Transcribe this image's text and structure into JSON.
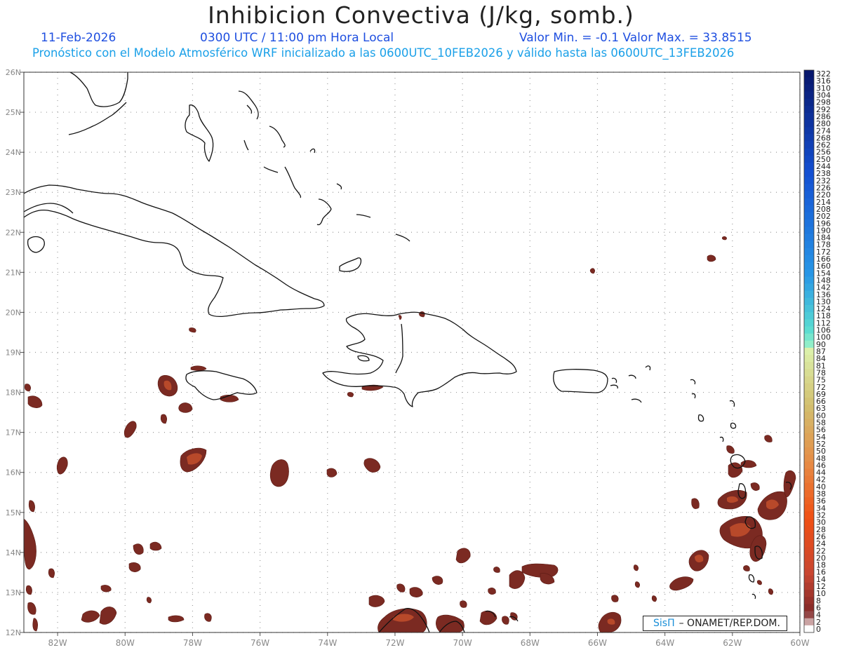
{
  "title": "Inhibicion Convectiva (J/kg, somb.)",
  "header": {
    "date": "11-Feb-2026",
    "time": "0300 UTC / 11:00 pm Hora Local",
    "minmax": "Valor Min. = -0.1  Valor Max. = 33.8515",
    "forecast": "Pronóstico con el Modelo Atmosférico WRF inicializado a las 0600UTC_10FEB2026 y válido hasta las  0600UTC_13FEB2026"
  },
  "map": {
    "lon_range": [
      -83,
      -60
    ],
    "lat_range": [
      12,
      26
    ],
    "lon_labels": [
      "82W",
      "80W",
      "78W",
      "76W",
      "74W",
      "72W",
      "70W",
      "68W",
      "66W",
      "64W",
      "62W",
      "60W"
    ],
    "lon_values": [
      -82,
      -80,
      -78,
      -76,
      -74,
      -72,
      -70,
      -68,
      -66,
      -64,
      -62,
      -60
    ],
    "lat_labels": [
      "26N",
      "25N",
      "24N",
      "23N",
      "22N",
      "21N",
      "20N",
      "19N",
      "18N",
      "17N",
      "16N",
      "15N",
      "14N",
      "13N",
      "12N"
    ],
    "lat_values": [
      26,
      25,
      24,
      23,
      22,
      21,
      20,
      19,
      18,
      17,
      16,
      15,
      14,
      13,
      12
    ],
    "colors": {
      "coast": "#111111",
      "grid": "#9a9a9a",
      "axis_text": "#888888",
      "shade_dark": "#7b2a22",
      "shade_mid": "#9a3a26",
      "shade_light": "#c8502a"
    }
  },
  "colorbar": {
    "labels": [
      "322",
      "316",
      "310",
      "304",
      "298",
      "292",
      "286",
      "280",
      "274",
      "268",
      "262",
      "256",
      "250",
      "244",
      "238",
      "232",
      "226",
      "220",
      "214",
      "208",
      "202",
      "196",
      "190",
      "184",
      "178",
      "172",
      "166",
      "160",
      "154",
      "148",
      "142",
      "136",
      "130",
      "124",
      "118",
      "112",
      "106",
      "100",
      "90",
      "87",
      "84",
      "81",
      "78",
      "75",
      "72",
      "69",
      "66",
      "63",
      "60",
      "58",
      "56",
      "54",
      "52",
      "50",
      "48",
      "46",
      "44",
      "42",
      "40",
      "38",
      "36",
      "34",
      "32",
      "30",
      "28",
      "26",
      "24",
      "22",
      "20",
      "18",
      "16",
      "14",
      "12",
      "10",
      "8",
      "6",
      "4",
      "2",
      "0"
    ]
  },
  "credit": {
    "brand": "SisΠ",
    "org": "– ONAMET/REP.DOM."
  }
}
